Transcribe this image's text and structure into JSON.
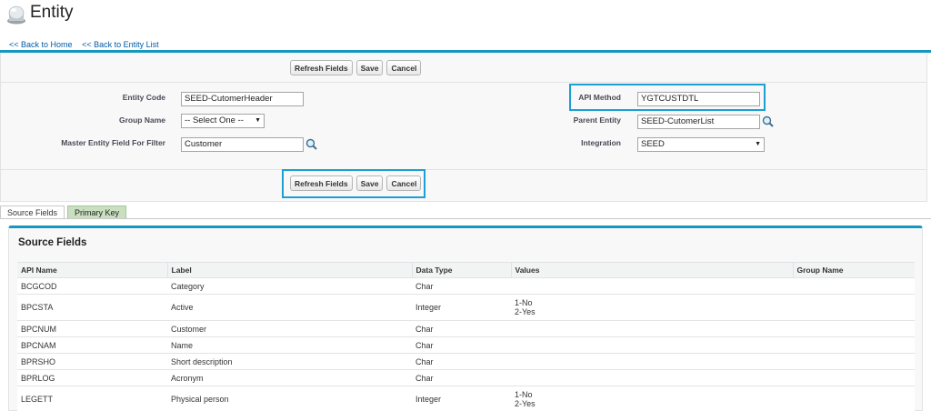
{
  "header": {
    "title": "Entity",
    "back_home": "<< Back to Home",
    "back_list": "<< Back to Entity List"
  },
  "buttons": {
    "refresh": "Refresh Fields",
    "save": "Save",
    "cancel": "Cancel"
  },
  "form": {
    "entity_code": {
      "label": "Entity Code",
      "value": "SEED-CutomerHeader"
    },
    "group_name": {
      "label": "Group Name",
      "value": "-- Select One --"
    },
    "master_entity": {
      "label": "Master Entity Field For Filter",
      "value": "Customer"
    },
    "api_method": {
      "label": "API Method",
      "value": "YGTCUSTDTL"
    },
    "parent_entity": {
      "label": "Parent Entity",
      "value": "SEED-CutomerList"
    },
    "integration": {
      "label": "Integration",
      "value": "SEED"
    }
  },
  "tabs": [
    "Source Fields",
    "Primary Key"
  ],
  "section": {
    "title": "Source Fields",
    "columns": [
      "API Name",
      "Label",
      "Data Type",
      "Values",
      "Group Name"
    ],
    "rows": [
      {
        "api": "BCGCOD",
        "label": "Category",
        "type": "Char",
        "v1": "",
        "v2": ""
      },
      {
        "api": "BPCSTA",
        "label": "Active",
        "type": "Integer",
        "v1": "1-No",
        "v2": "2-Yes"
      },
      {
        "api": "BPCNUM",
        "label": "Customer",
        "type": "Char",
        "v1": "",
        "v2": ""
      },
      {
        "api": "BPCNAM",
        "label": "Name",
        "type": "Char",
        "v1": "",
        "v2": ""
      },
      {
        "api": "BPRSHO",
        "label": "Short description",
        "type": "Char",
        "v1": "",
        "v2": ""
      },
      {
        "api": "BPRLOG",
        "label": "Acronym",
        "type": "Char",
        "v1": "",
        "v2": ""
      },
      {
        "api": "LEGETT",
        "label": "Physical person",
        "type": "Integer",
        "v1": "1-No",
        "v2": "2-Yes"
      }
    ]
  },
  "colors": {
    "accent": "#1797c0",
    "highlight": "#1d9fd4",
    "link": "#015ba7",
    "tab_green": "#c8dfc0"
  }
}
